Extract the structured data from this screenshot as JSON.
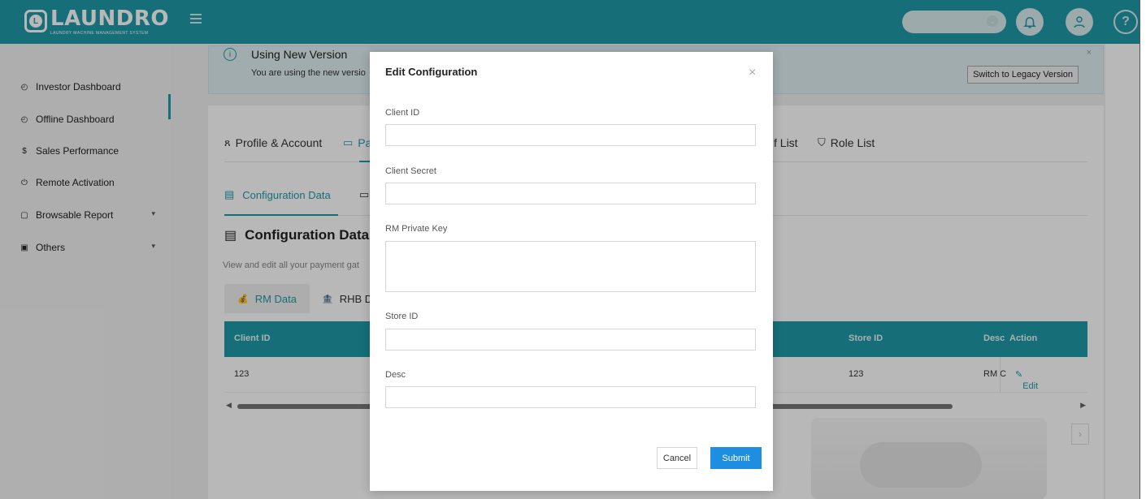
{
  "header": {
    "logo_text": "LAUNDRO",
    "logo_mark": "L",
    "logo_sub": "LAUNDRY MACHINE MANAGEMENT SYSTEM",
    "brand_color": "#1f9aa7",
    "icons": [
      "menu-icon",
      "bell-icon",
      "user-icon",
      "help-icon"
    ]
  },
  "sidebar": {
    "items": [
      {
        "label": "Investor Dashboard",
        "icon": "dashboard-icon"
      },
      {
        "label": "Offline Dashboard",
        "icon": "dashboard-icon"
      },
      {
        "label": "Sales Performance",
        "icon": "dollar-icon"
      },
      {
        "label": "Remote Activation",
        "icon": "power-icon"
      },
      {
        "label": "Browsable Report",
        "icon": "report-icon"
      },
      {
        "label": "Others",
        "icon": "folder-icon"
      }
    ],
    "active_index": 2
  },
  "banner": {
    "title": "Using New Version",
    "desc": "You are using the new versio",
    "legacy_button": "Switch to Legacy Version",
    "close": "×"
  },
  "tabs_main": {
    "profile": "Profile & Account",
    "payment": "Pa",
    "staff": "f List",
    "role": "Role List"
  },
  "tabs_sub": {
    "config": "Configuration Data"
  },
  "section": {
    "title": "Configuration Data",
    "desc": "View and edit all your payment gat"
  },
  "tabs_data": {
    "rm": "RM Data",
    "rhb": "RHB D"
  },
  "table": {
    "headers": {
      "client_id": "Client ID",
      "store_id": "Store ID",
      "desc": "Desc",
      "action": "Action"
    },
    "row": {
      "client_id": "123",
      "store_id": "123",
      "desc": "RM C",
      "action": "Edit"
    }
  },
  "modal": {
    "title": "Edit Configuration",
    "close": "×",
    "fields": {
      "client_id": {
        "label": "Client ID",
        "value": ""
      },
      "client_secret": {
        "label": "Client Secret",
        "value": ""
      },
      "rm_private_key": {
        "label": "RM Private Key",
        "value": ""
      },
      "store_id": {
        "label": "Store ID",
        "value": ""
      },
      "desc": {
        "label": "Desc",
        "value": ""
      }
    },
    "cancel": "Cancel",
    "submit": "Submit",
    "submit_color": "#1f8ee0"
  }
}
